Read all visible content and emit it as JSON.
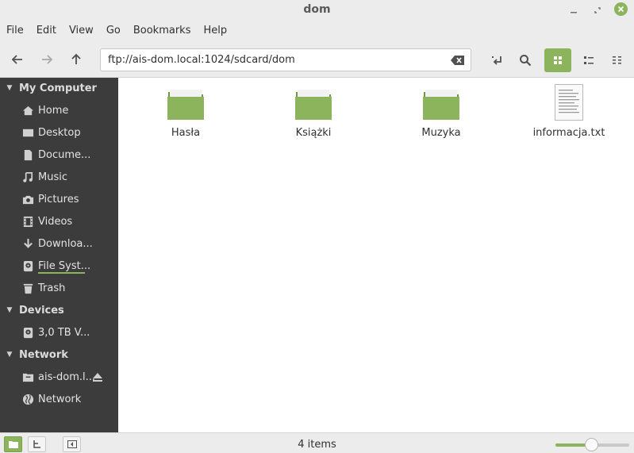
{
  "window": {
    "title": "dom"
  },
  "menu": [
    "File",
    "Edit",
    "View",
    "Go",
    "Bookmarks",
    "Help"
  ],
  "location": {
    "path": "ftp://ais-dom.local:1024/sdcard/dom"
  },
  "sidebar": {
    "sections": [
      {
        "title": "My Computer",
        "items": [
          {
            "label": "Home",
            "icon": "home-icon"
          },
          {
            "label": "Desktop",
            "icon": "desktop-icon"
          },
          {
            "label": "Docume...",
            "icon": "document-icon"
          },
          {
            "label": "Music",
            "icon": "music-icon"
          },
          {
            "label": "Pictures",
            "icon": "camera-icon"
          },
          {
            "label": "Videos",
            "icon": "film-icon"
          },
          {
            "label": "Downloa...",
            "icon": "download-icon"
          },
          {
            "label": "File Syst...",
            "icon": "drive-icon"
          },
          {
            "label": "Trash",
            "icon": "trash-icon"
          }
        ]
      },
      {
        "title": "Devices",
        "items": [
          {
            "label": "3,0 TB V...",
            "icon": "drive-icon"
          }
        ]
      },
      {
        "title": "Network",
        "items": [
          {
            "label": "ais-dom.l...",
            "icon": "network-folder-icon"
          },
          {
            "label": "Network",
            "icon": "globe-icon"
          }
        ]
      }
    ]
  },
  "files": [
    {
      "name": "Hasła",
      "type": "folder"
    },
    {
      "name": "Książki",
      "type": "folder"
    },
    {
      "name": "Muzyka",
      "type": "folder"
    },
    {
      "name": "informacja.txt",
      "type": "text"
    }
  ],
  "status": {
    "count": "4 items",
    "zoom_fraction": 0.48
  },
  "colors": {
    "accent": "#8cb45d",
    "sidebar_bg": "#3c3c3c"
  }
}
